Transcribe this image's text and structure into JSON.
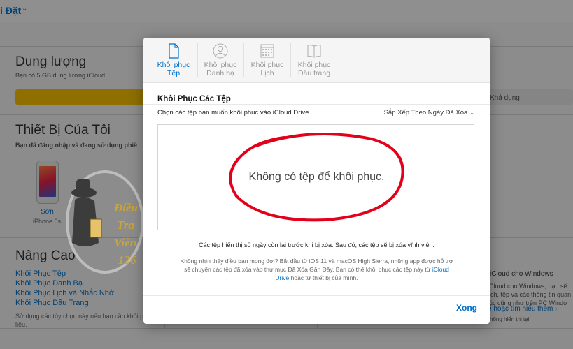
{
  "background": {
    "settings_label": "i Đặt",
    "storage": {
      "title": "Dung lượng",
      "subtitle": "Bạn có 5 GB dung lượng iCloud.",
      "available": "Khả dụng"
    },
    "devices": {
      "title": "Thiết Bị Của Tôi",
      "subtitle": "Bạn đã đăng nhập và đang sử dụng phiê",
      "device_name": "Sơn",
      "device_model": "iPhone 6s"
    },
    "advanced": {
      "title": "Nâng Cao",
      "links": [
        "Khôi Phục Tệp",
        "Khôi Phục Danh Bạ",
        "Khôi Phục Lịch và Nhắc Nhở",
        "Khôi Phục Dấu Trang"
      ],
      "note": "Sử dụng các tùy chọn này nếu bạn cần khôi p dữ liệu."
    },
    "right_panel": {
      "title": "iCloud cho Windows",
      "text": "iCloud cho Windows, bạn sẽ lịch, tệp và các thông tin quan lúc cũng như trên PC Windo",
      "link": "ể hoặc tìm hiểu thêm ›",
      "small": "hông hiển thị tại"
    },
    "watermark": {
      "line1": "Điều",
      "line2": "Tra",
      "line3": "Viên",
      "line4": "126"
    }
  },
  "modal": {
    "tabs": [
      {
        "label": "Khôi phục Tệp",
        "line1": "Khôi phục",
        "line2": "Tệp",
        "icon": "document-icon",
        "active": true
      },
      {
        "label": "Khôi phục Danh bạ",
        "line1": "Khôi phục",
        "line2": "Danh bạ",
        "icon": "contact-icon",
        "active": false
      },
      {
        "label": "Khôi phục Lịch",
        "line1": "Khôi phục",
        "line2": "Lịch",
        "icon": "calendar-icon",
        "active": false
      },
      {
        "label": "Khôi phục Dấu trang",
        "line1": "Khôi phục",
        "line2": "Dấu trang",
        "icon": "bookmark-icon",
        "active": false
      }
    ],
    "title": "Khôi Phục Các Tệp",
    "instruction": "Chọn các tệp bạn muốn khôi phục vào iCloud Drive.",
    "sort_label": "Sắp Xếp Theo Ngày Đã Xóa",
    "empty_message": "Không có tệp để khôi phục.",
    "retention": "Các tệp hiển thị số ngày còn lại trước khi bị xóa. Sau đó, các tệp sẽ bị xóa vĩnh viễn.",
    "info_part1": "Không nhìn thấy điều bạn mong đợi? Bắt đầu từ iOS 11 và macOS High Sierra, những app được hỗ trợ sẽ chuyển các tệp đã xóa vào thư mục Đã Xóa Gần Đây. Bạn có thể khôi phục các tệp này từ ",
    "info_link": "iCloud Drive",
    "info_part2": " hoặc từ thiết bị của mình.",
    "done_label": "Xong"
  },
  "colors": {
    "accent": "#0070c9",
    "storage_fill": "#f4c000",
    "highlight": "#e3001b"
  }
}
